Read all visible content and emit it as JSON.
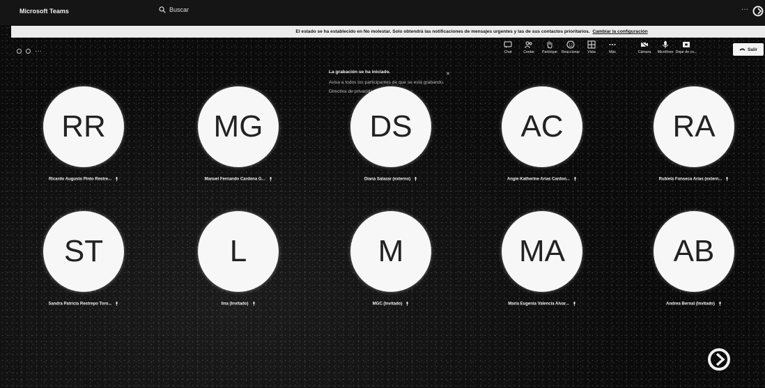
{
  "app": {
    "title": "Microsoft Teams"
  },
  "search": {
    "label": "Buscar"
  },
  "banner": {
    "text": "El estado se ha establecido en No molestar. Solo obtendrá las notificaciones de mensajes urgentes y las de sus contactos prioritarios.",
    "link": "Cambiar la configuración"
  },
  "meeting": {
    "controls_left": "○ ○ ···"
  },
  "toolbar": {
    "items": [
      {
        "label": "Chat",
        "icon": "chat-icon"
      },
      {
        "label": "Contar",
        "icon": "people-icon"
      },
      {
        "label": "Participar",
        "icon": "hand-icon"
      },
      {
        "label": "Reaccionar",
        "icon": "smiley-icon"
      },
      {
        "label": "Vista",
        "icon": "grid-icon"
      },
      {
        "label": "Más",
        "icon": "more-icon"
      },
      {
        "label": "Cámara",
        "icon": "camera-icon"
      },
      {
        "label": "Micrófono",
        "icon": "mic-icon"
      },
      {
        "label": "Dejar de co...",
        "icon": "share-icon"
      }
    ],
    "exit_label": "Salir"
  },
  "toast": {
    "title": "La grabación se ha iniciado.",
    "line1": "Avisa a todos los participantes de que se está grabando.",
    "line2": "Directiva de privacidad"
  },
  "participants": [
    {
      "initials": "RR",
      "name": "Ricardo Augusto Pinto Restre..."
    },
    {
      "initials": "MG",
      "name": "Manuel Fernando Cardona G..."
    },
    {
      "initials": "DS",
      "name": "Diana Salazar (externo)"
    },
    {
      "initials": "AC",
      "name": "Angie Katherine Arias Cardon..."
    },
    {
      "initials": "RA",
      "name": "Rubiela Fonseca Arias (extern..."
    },
    {
      "initials": "ST",
      "name": "Sandra Patricia Restrepo Toro..."
    },
    {
      "initials": "L",
      "name": "lina (Invitado)"
    },
    {
      "initials": "M",
      "name": "MGC (Invitado)"
    },
    {
      "initials": "MA",
      "name": "María Eugenia Valencia Alvar..."
    },
    {
      "initials": "AB",
      "name": "Andrea Bernal (Invitado)"
    }
  ]
}
